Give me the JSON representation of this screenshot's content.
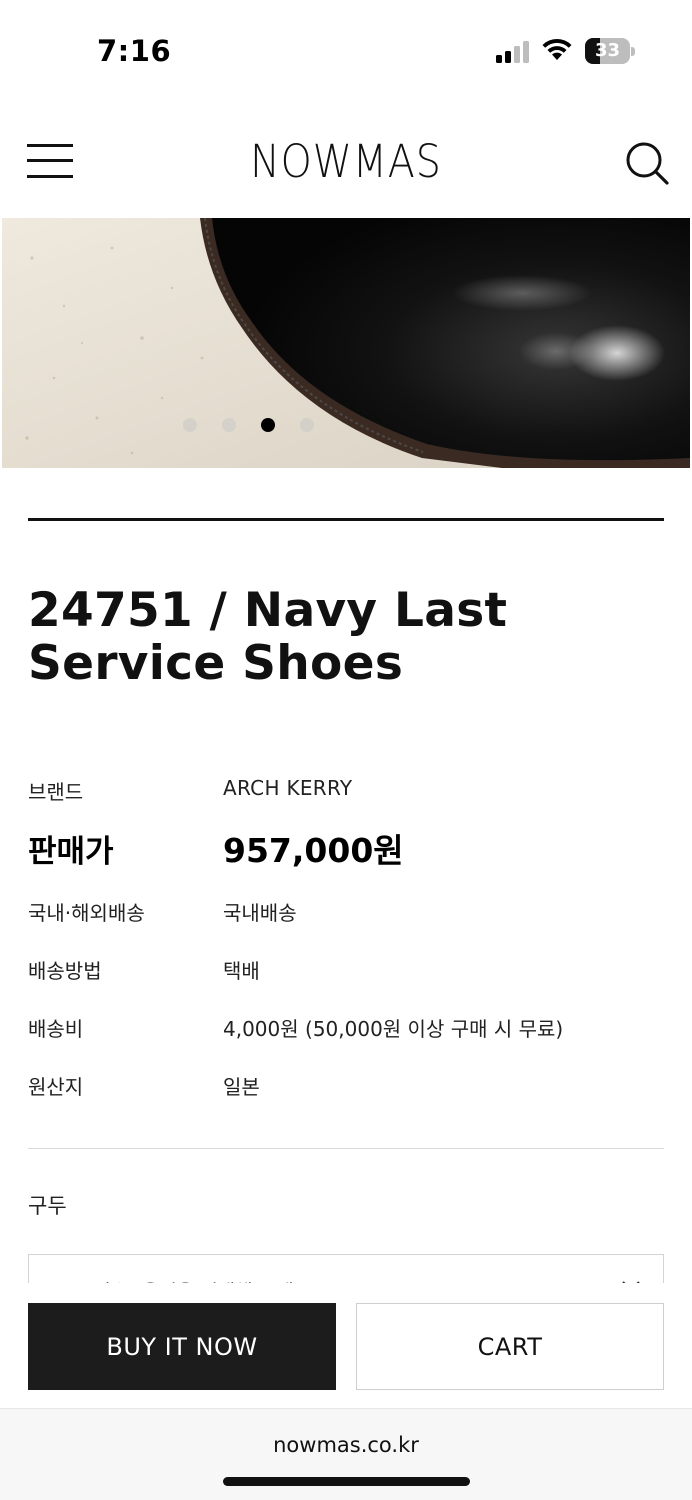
{
  "status_bar": {
    "time": "7:16",
    "battery_level": "33",
    "battery_fraction": 0.33,
    "icons": [
      "signal-icon",
      "wifi-icon",
      "battery-icon"
    ]
  },
  "header": {
    "brand": "NOWMAS",
    "icons": [
      "hamburger-menu-icon",
      "search-icon"
    ]
  },
  "hero": {
    "carousel_total": 4,
    "carousel_active_index": 2
  },
  "product": {
    "title": "24751 / Navy Last Service Shoes",
    "info": {
      "brand_label": "브랜드",
      "brand_value": "ARCH KERRY",
      "price_label": "판매가",
      "price_value": "957,000원",
      "shipping_type_label": "국내·해외배송",
      "shipping_type_value": "국내배송",
      "shipping_method_label": "배송방법",
      "shipping_method_value": "택배",
      "shipping_fee_label": "배송비",
      "shipping_fee_value": "4,000원 (50,000원 이상 구매 시 무료)",
      "origin_label": "원산지",
      "origin_value": "일본"
    },
    "option": {
      "title": "구두",
      "select_placeholder": "- [필수] 옵션을 선택해 주세요 -"
    }
  },
  "actions": {
    "buy_now_label": "BUY IT NOW",
    "cart_label": "CART"
  },
  "browser": {
    "url": "nowmas.co.kr"
  },
  "colors": {
    "primary_button": "#1c1c1c",
    "text": "#111111",
    "divider": "#d9d9d9"
  }
}
